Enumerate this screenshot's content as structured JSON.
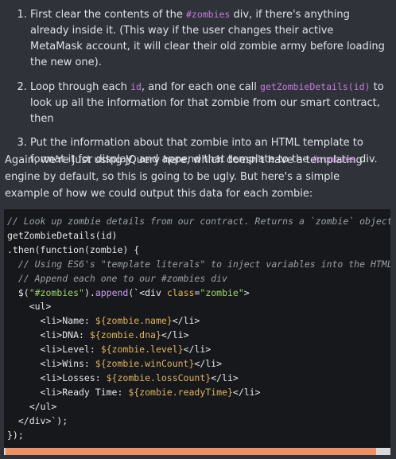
{
  "steps": [
    {
      "pre": "First clear the contents of the ",
      "code": "#zombies",
      "post": " div, if there's anything already inside it. (This way if the user changes their active MetaMask account, it will clear their old zombie army before loading the new one)."
    },
    {
      "pre": "Loop through each ",
      "code": "id",
      "mid": ", and for each one call ",
      "code2": "getZombieDetails(id)",
      "post": " to look up all the information for that zombie from our smart contract, then"
    },
    {
      "pre": "Put the information about that zombie into an HTML template to format it for display, and append that template to the ",
      "code": "#zombies",
      "post": " div."
    }
  ],
  "paragraph": "Again, we're just using JQuery here, which doesn't have a templating engine by default, so this is going to be ugly. But here's a simple example of how we could output this data for each zombie:",
  "code": {
    "l1": "// Look up zombie details from our contract. Returns a `zombie` object",
    "l2": "getZombieDetails(id)",
    "l3": ".then(function(zombie) {",
    "l4": "  // Using ES6's \"template literals\" to inject variables into the HTML.",
    "l5": "  // Append each one to our #zombies div",
    "l6a": "  $(",
    "l6b": "\"#zombies\"",
    "l6c": ").",
    "l6d": "append",
    "l6e": "(`<div ",
    "l6f": "class",
    "l6g": "=",
    "l6h": "\"zombie\"",
    "l6i": ">",
    "l7": "    <ul>",
    "rows": [
      {
        "pre": "      <li>Name: ",
        "expr": "${zombie.name}",
        "post": "</li>"
      },
      {
        "pre": "      <li>DNA: ",
        "expr": "${zombie.dna}",
        "post": "</li>"
      },
      {
        "pre": "      <li>Level: ",
        "expr": "${zombie.level}",
        "post": "</li>"
      },
      {
        "pre": "      <li>Wins: ",
        "expr": "${zombie.winCount}",
        "post": "</li>"
      },
      {
        "pre": "      <li>Losses: ",
        "expr": "${zombie.lossCount}",
        "post": "</li>"
      },
      {
        "pre": "      <li>Ready Time: ",
        "expr": "${zombie.readyTime}",
        "post": "</li>"
      }
    ],
    "l14": "    </ul>",
    "l15": "  </div>`);",
    "l16": "});"
  },
  "scrollbar": {
    "position": 0.96
  }
}
